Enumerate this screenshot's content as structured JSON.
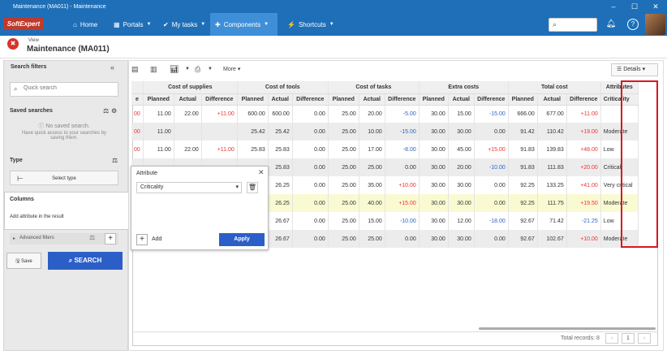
{
  "window": {
    "title": "Maintenance (MA011) - Maintenance"
  },
  "brand": {
    "logo": "SoftExpert"
  },
  "nav": {
    "home": "Home",
    "portals": "Portals",
    "tasks": "My tasks",
    "components": "Components",
    "shortcuts": "Shortcuts"
  },
  "page": {
    "crumb": "View",
    "title": "Maintenance (MA011)"
  },
  "sidebar": {
    "title": "Search filters",
    "search_placeholder": "Quick search",
    "saved_title": "Saved searches",
    "saved_empty": "No saved search.",
    "saved_hint": "Have quick access to your searches by saving them.",
    "type_label": "Type",
    "select_type": "Select type",
    "advanced": "Advanced filters",
    "save": "Save",
    "search": "SEARCH"
  },
  "columns_panel": {
    "title": "Columns",
    "text": "Add attribute in the result"
  },
  "popup": {
    "title": "Attribute",
    "selected": "Criticality",
    "add": "Add",
    "apply": "Apply"
  },
  "toolbar": {
    "more": "More",
    "details": "Details"
  },
  "table": {
    "groups": [
      "Cost of supplies",
      "Cost of tools",
      "Cost of tasks",
      "Extra costs",
      "Total cost",
      "Attributes"
    ],
    "subheaders": [
      "e",
      "Planned",
      "Actual",
      "Difference",
      "Planned",
      "Actual",
      "Difference",
      "Planned",
      "Actual",
      "Difference",
      "Planned",
      "Actual",
      "Difference",
      "Planned",
      "Actual",
      "Difference",
      "Criticality"
    ],
    "rows": [
      [
        "00",
        "11.00",
        "22.00",
        "+11.00",
        "600.00",
        "600.00",
        "0.00",
        "25.00",
        "20.00",
        "-5.00",
        "30.00",
        "15.00",
        "-15.00",
        "666.00",
        "677.00",
        "+11.00",
        ""
      ],
      [
        "00",
        "11.00",
        "",
        "",
        "25.42",
        "25.42",
        "0.00",
        "25.00",
        "10.00",
        "-15.00",
        "30.00",
        "30.00",
        "0.00",
        "91.42",
        "110.42",
        "+19.00",
        "Moderate"
      ],
      [
        "00",
        "11.00",
        "22.00",
        "+11.00",
        "25.83",
        "25.83",
        "0.00",
        "25.00",
        "17.00",
        "-8.00",
        "30.00",
        "45.00",
        "+15.00",
        "91.83",
        "139.83",
        "+48.00",
        "Low"
      ],
      [
        "",
        "",
        "",
        "",
        "",
        "25.83",
        "0.00",
        "25.00",
        "25.00",
        "0.00",
        "30.00",
        "20.00",
        "-10.00",
        "91.83",
        "111.83",
        "+20.00",
        "Critical"
      ],
      [
        "",
        "",
        "",
        "",
        "",
        "26.25",
        "0.00",
        "25.00",
        "35.00",
        "+10.00",
        "30.00",
        "30.00",
        "0.00",
        "92.25",
        "133.25",
        "+41.00",
        "Very critical"
      ],
      [
        "",
        "",
        "",
        "",
        "",
        "26.25",
        "0.00",
        "25.00",
        "40.00",
        "+15.00",
        "30.00",
        "30.00",
        "0.00",
        "92.25",
        "111.75",
        "+19.50",
        "Moderate"
      ],
      [
        "",
        "",
        "",
        "",
        "",
        "26.67",
        "0.00",
        "25.00",
        "15.00",
        "-10.00",
        "30.00",
        "12.00",
        "-18.00",
        "92.67",
        "71.42",
        "-21.25",
        "Low"
      ],
      [
        "",
        "",
        "",
        "",
        "",
        "26.67",
        "0.00",
        "25.00",
        "25.00",
        "0.00",
        "30.00",
        "30.00",
        "0.00",
        "92.67",
        "102.67",
        "+10.00",
        "Moderate"
      ]
    ]
  },
  "footer": {
    "total": "Total records: 8",
    "page": "1"
  },
  "colors": {
    "primary": "#1e6fb8",
    "accent": "#2c5ec7",
    "highlight": "#d71920"
  }
}
